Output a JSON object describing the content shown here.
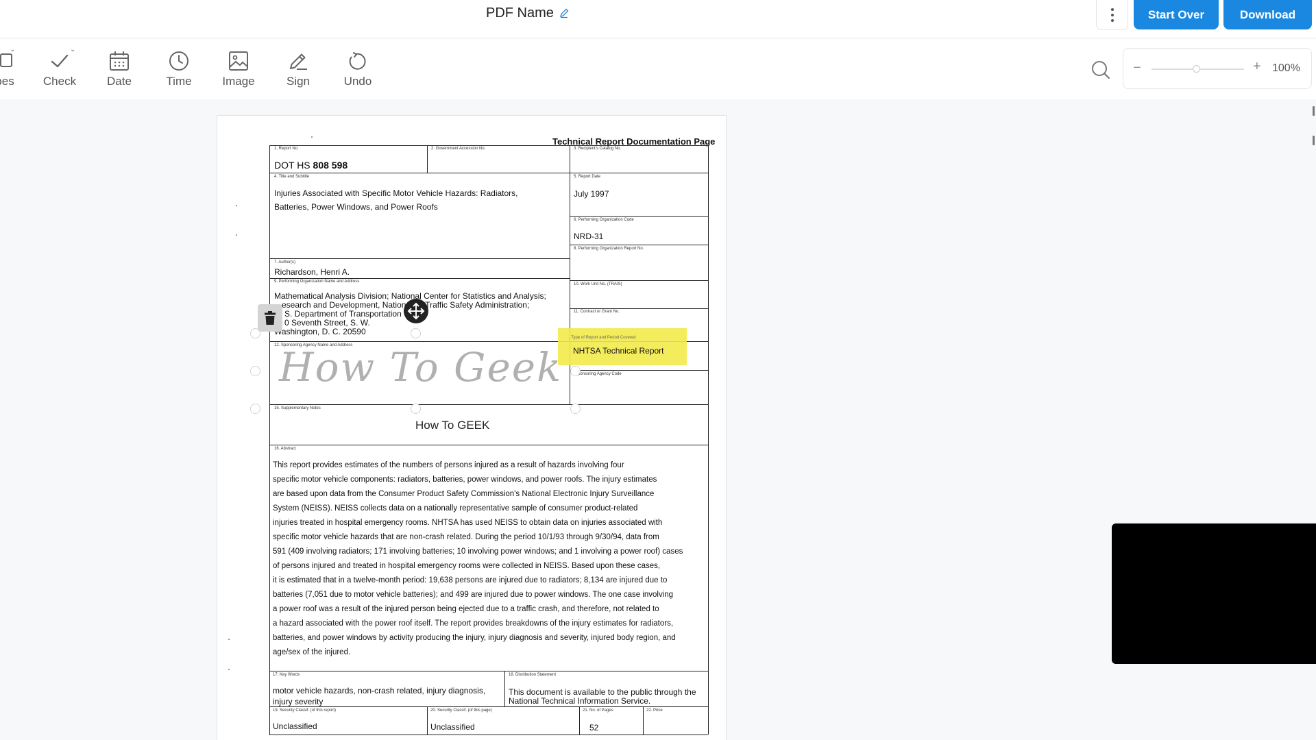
{
  "header": {
    "doc_title": "PDF Name",
    "start_over_label": "Start Over",
    "download_label": "Download"
  },
  "toolbar": {
    "tools": [
      {
        "label": "pes",
        "icon": "shapes-icon"
      },
      {
        "label": "Check",
        "icon": "check-icon"
      },
      {
        "label": "Date",
        "icon": "calendar-icon"
      },
      {
        "label": "Time",
        "icon": "clock-icon"
      },
      {
        "label": "Image",
        "icon": "image-icon"
      },
      {
        "label": "Sign",
        "icon": "pen-icon"
      },
      {
        "label": "Undo",
        "icon": "undo-icon"
      }
    ],
    "zoom": {
      "minus": "−",
      "plus": "+",
      "value": "100%"
    }
  },
  "document": {
    "heading": "Technical Report Documentation Page",
    "fields": {
      "f1_label": "1. Report No.",
      "f1_value_prefix": "DOT HS",
      "f1_value_num": "808 598",
      "f2_label": "2. Government Accession No.",
      "f3_label": "3. Recipient's Catalog No.",
      "f4_label": "4. Title and Subtitle",
      "f4_value_1": "Injuries Associated with Specific Motor Vehicle Hazards: Radiators,",
      "f4_value_2": "Batteries, Power Windows, and Power Roofs",
      "f5_label": "5. Report Date",
      "f5_value": "July 1997",
      "f6_label": "6. Performing Organization Code",
      "f6_value": "NRD-31",
      "f7_label": "7. Author(s)",
      "f7_value": "Richardson, Henri A.",
      "f8_label": "8. Performing Organization Report No.",
      "f9_label": "9. Performing Organization Name and Address",
      "f9_value_1": "Mathematical Analysis Division; National Center for Statistics and Analysis;",
      "f9_value_2": "esearch and Development, Nation      way Traffic Safety Administration;",
      "f9_value_3": "S. Department of Transportation",
      "f9_value_4": "0 Seventh Street, S. W.",
      "f9_value_5": "Washington, D. C. 20590",
      "f10_label": "10. Work Unit No. (TRAIS)",
      "f11_label": "11. Contract or Grant No.",
      "f12_label": "12. Sponsoring Agency Name and Address",
      "f13_label": ". Type of Report and Period Covered",
      "f13_value": "NHTSA Technical Report",
      "f14_label": "Sponsoring Agency Code",
      "f15_label": "15. Supplementary Notes",
      "f16_label": "16. Abstract",
      "f17_label": "17. Key Words",
      "f17_value_1": "motor vehicle hazards, non-crash related, injury diagnosis,",
      "f17_value_2": "injury severity",
      "f18_label": "18. Distribution Statement",
      "f18_value_1": "This document is available to the public through the",
      "f18_value_2": "National Technical Information Service.",
      "f19_label": "19. Security Classif. (of this report)",
      "f19_value": "Unclassified",
      "f20_label": "20. Security Classif. (of this page)",
      "f20_value": "Unclassified",
      "f21_label": "21. No. of Pages",
      "f21_value": "52",
      "f22_label": "22. Price"
    },
    "abstract_lines": [
      "     This report provides estimates of the numbers of persons injured as a result of hazards involving four",
      "specific motor vehicle components: radiators, batteries, power windows, and power roofs.  The injury estimates",
      "are based upon data from the Consumer Product Safety Commission's National Electronic Injury Surveillance",
      "System (NEISS).  NEISS collects data on a nationally representative sample of consumer product-related",
      "injuries treated in hospital emergency rooms.  NHTSA has used NEISS to obtain data on injuries associated with",
      "specific motor vehicle hazards that are non-crash related.  During the period 10/1/93 through 9/30/94, data from",
      "591 (409 involving radiators; 171 involving batteries; 10 involving power windows; and 1 involving a power roof) cases",
      "of persons injured and treated in hospital emergency rooms were collected in NEISS.  Based upon these cases,",
      "it is estimated that in a twelve-month period: 19,638 persons are injured due to radiators; 8,134 are injured due to",
      "batteries (7,051 due to motor vehicle batteries); and 499 are injured due to power windows.  The one case involving",
      "a power roof was a result of the injured person being ejected due to a traffic crash, and therefore, not related to",
      "a hazard associated with the power roof itself.  The report provides breakdowns of the injury estimates for radiators,",
      "batteries, and power windows by activity producing the injury, injury diagnosis and severity, injured body region, and",
      "age/sex of the injured."
    ],
    "signature_text": "How To Geek",
    "text_annotation": "How To GEEK"
  }
}
